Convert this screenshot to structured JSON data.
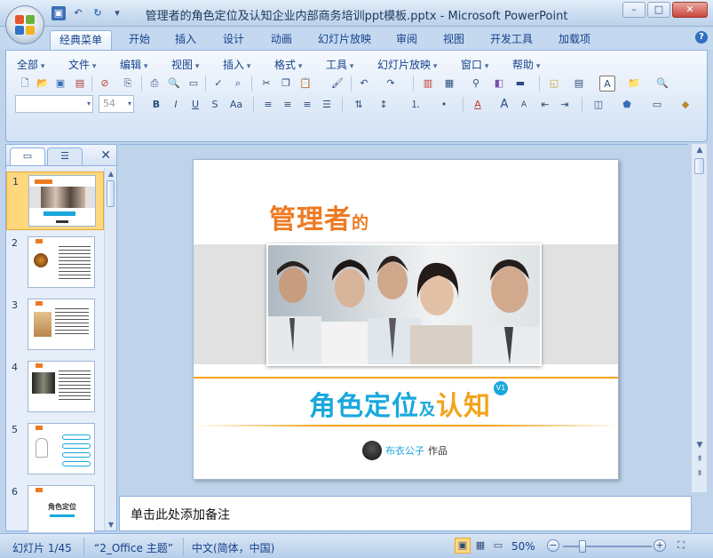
{
  "window": {
    "title": "管理者的角色定位及认知企业内部商务培训ppt模板.pptx - Microsoft PowerPoint",
    "controls": [
      "–",
      "□",
      "✕"
    ]
  },
  "qat": [
    "save-icon",
    "undo-icon",
    "redo-icon",
    "customize-icon"
  ],
  "ribbon_tabs": [
    {
      "label": "经典菜单",
      "active": true
    },
    {
      "label": "开始"
    },
    {
      "label": "插入"
    },
    {
      "label": "设计"
    },
    {
      "label": "动画"
    },
    {
      "label": "幻灯片放映"
    },
    {
      "label": "审阅"
    },
    {
      "label": "视图"
    },
    {
      "label": "开发工具"
    },
    {
      "label": "加载项"
    }
  ],
  "menus": [
    "全部",
    "文件",
    "编辑",
    "视图",
    "插入",
    "格式",
    "工具",
    "幻灯片放映",
    "窗口",
    "帮助"
  ],
  "font_size": "54",
  "font_style": {
    "bold": "B",
    "italic": "I",
    "underline": "U",
    "strike": "S",
    "shadow": "Aa"
  },
  "left_pane": {
    "thumbnails": [
      {
        "num": "1",
        "selected": true
      },
      {
        "num": "2"
      },
      {
        "num": "3"
      },
      {
        "num": "4"
      },
      {
        "num": "5"
      },
      {
        "num": "6",
        "text": "角色定位"
      }
    ]
  },
  "slide": {
    "title_main": "管理者",
    "title_suffix": "的",
    "subtitle_part1": "角色定位",
    "subtitle_small": "及",
    "subtitle_part2": "认知",
    "badge": "V1",
    "author_blue": "布衣公子",
    "author_dark": "作品"
  },
  "notes_placeholder": "单击此处添加备注",
  "status": {
    "slide_info": "幻灯片 1/45",
    "theme": "“2_Office 主题”",
    "language": "中文(简体，中国)",
    "zoom": "50%",
    "zoom_level_percent": 50
  },
  "colors": {
    "accent_orange": "#ee7a22",
    "accent_blue": "#19a8dd",
    "accent_yellow": "#f3a41c",
    "ribbon": "#dfeaf8"
  }
}
